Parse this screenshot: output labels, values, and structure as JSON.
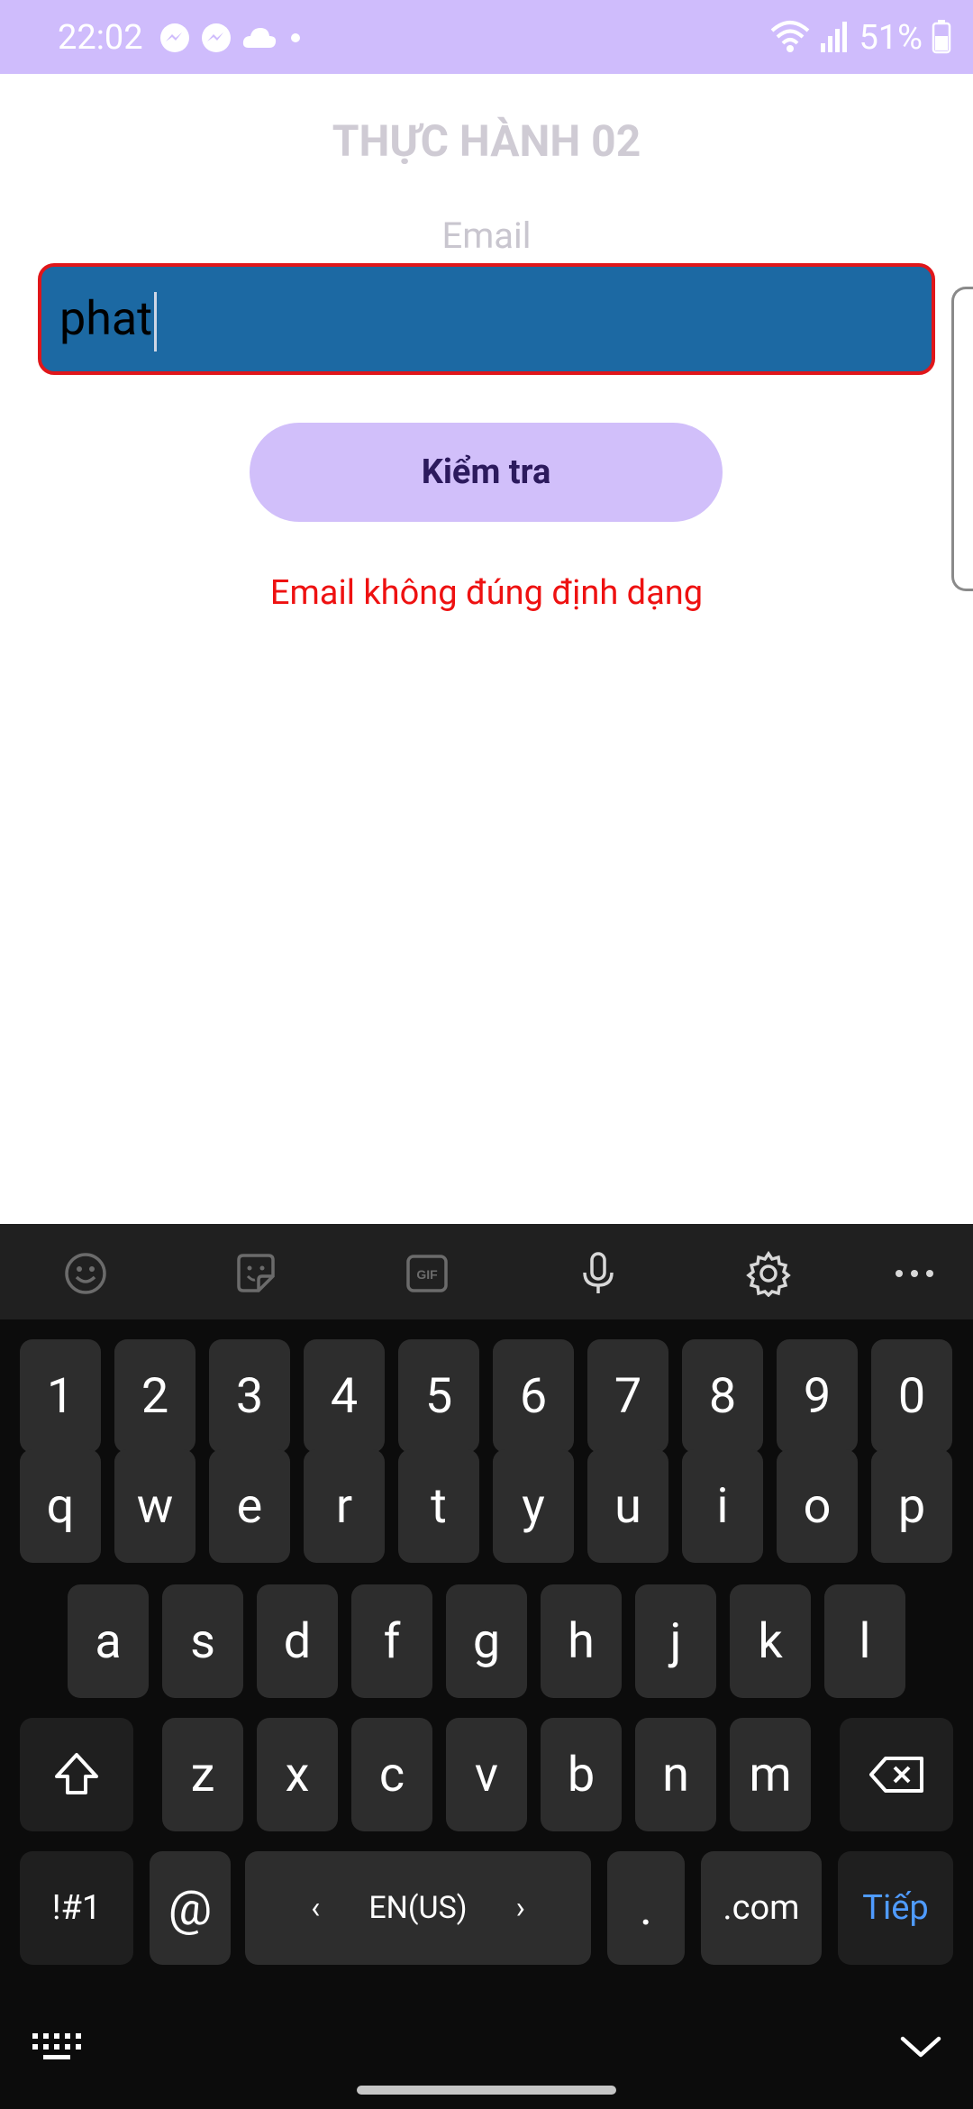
{
  "status_bar": {
    "time": "22:02",
    "battery": "51%",
    "color": "#cfbcfc"
  },
  "screen": {
    "title": "THỰC HÀNH 02",
    "email_label": "Email",
    "email_value": "phat",
    "check_button": "Kiểm tra",
    "error_message": "Email không đúng định dạng",
    "accent_color": "#d1bffa",
    "error_color": "#ee1111",
    "input_bg_color": "#1c69a3"
  },
  "keyboard": {
    "toolbar_icons": [
      "emoji-icon",
      "sticker-icon",
      "gif-icon",
      "microphone-icon",
      "settings-gear-icon",
      "more-options-icon"
    ],
    "number_row": [
      "1",
      "2",
      "3",
      "4",
      "5",
      "6",
      "7",
      "8",
      "9",
      "0"
    ],
    "row1": [
      "q",
      "w",
      "e",
      "r",
      "t",
      "y",
      "u",
      "i",
      "o",
      "p"
    ],
    "row2": [
      "a",
      "s",
      "d",
      "f",
      "g",
      "h",
      "j",
      "k",
      "l"
    ],
    "row3": [
      "z",
      "x",
      "c",
      "v",
      "b",
      "n",
      "m"
    ],
    "symbols_key": "!#1",
    "at_key": "@",
    "space_label": "EN(US)",
    "space_left_arrow": "‹",
    "space_right_arrow": "›",
    "period_key": ".",
    "dotcom_key": ".com",
    "action_key": "Tiếp"
  }
}
